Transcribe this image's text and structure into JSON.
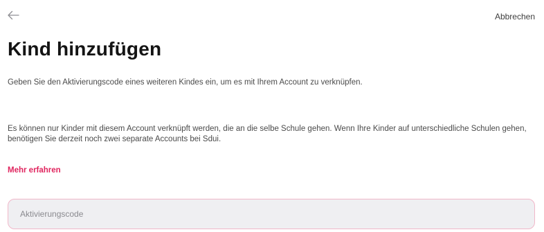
{
  "header": {
    "back_icon": "arrow-left-icon",
    "cancel_label": "Abbrechen"
  },
  "main": {
    "title": "Kind hinzufügen",
    "intro": "Geben Sie den Aktivierungscode eines weiteren Kindes ein, um es mit Ihrem Account zu verknüpfen.",
    "info": "Es können nur Kinder mit diesem Account verknüpft werden, die an die selbe Schule gehen. Wenn Ihre Kinder auf unterschiedliche Schulen gehen, benötigen Sie derzeit noch zwei separate Accounts bei Sdui.",
    "learn_more_label": "Mehr erfahren",
    "activation_code": {
      "value": "",
      "placeholder": "Aktivierungscode"
    }
  },
  "colors": {
    "accent": "#e0245e",
    "input_border": "#f1b7c9",
    "input_background": "#efeff2"
  }
}
